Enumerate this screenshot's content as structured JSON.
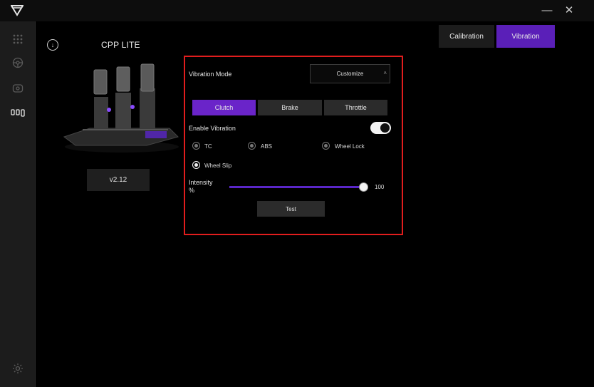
{
  "product": {
    "name": "CPP LITE",
    "version": "v2.12"
  },
  "tabs": {
    "calibration": "Calibration",
    "vibration": "Vibration"
  },
  "panel": {
    "vibration_mode_label": "Vibration Mode",
    "vibration_mode_value": "Customize",
    "segments": [
      "Clutch",
      "Brake",
      "Throttle"
    ],
    "enable_vibration_label": "Enable Vibration",
    "enable_vibration_on": true,
    "options": {
      "tc": "TC",
      "abs": "ABS",
      "wheel_lock": "Wheel Lock",
      "wheel_slip": "Wheel Slip"
    },
    "intensity_label": "Intensity",
    "intensity_unit": "%",
    "intensity_value": "100",
    "test_label": "Test"
  },
  "window": {
    "minimize": "—",
    "close": "✕"
  },
  "colors": {
    "accent": "#6a24c9",
    "highlight_border": "#e11d1d"
  }
}
